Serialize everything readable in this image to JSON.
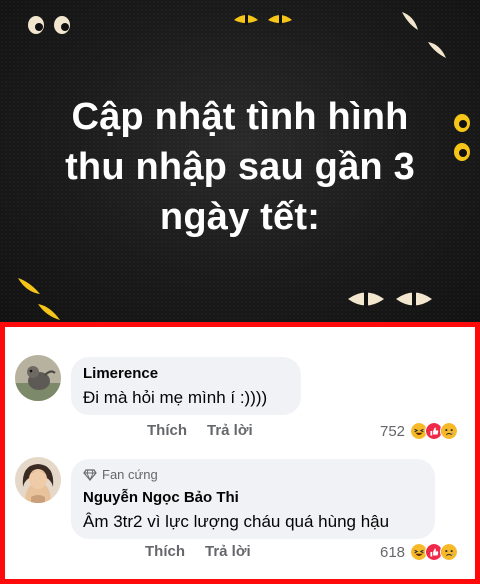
{
  "post": {
    "title_lines": [
      "Cập nhật tình hình",
      "thu nhập sau gần 3",
      "ngày tết:"
    ]
  },
  "comments": [
    {
      "author": "Limerence",
      "badge": "",
      "text": "Đi mà hỏi mẹ mình í :))))",
      "like_label": "Thích",
      "reply_label": "Trả lời",
      "reaction_count": "752",
      "reactions": [
        "haha",
        "like",
        "sad"
      ]
    },
    {
      "author": "Nguyễn Ngọc Bảo Thi",
      "badge": "Fan cứng",
      "text": "Âm 3tr2 vì lực lượng cháu quá hùng hậu",
      "like_label": "Thích",
      "reply_label": "Trả lời",
      "reaction_count": "618",
      "reactions": [
        "haha",
        "like",
        "sad"
      ]
    }
  ],
  "colors": {
    "banner_bg": "#1a1a1a",
    "eye_color": "#f5c518",
    "highlight_border": "#ff0a0a",
    "bubble_bg": "#f0f2f5",
    "secondary_text": "#65676b"
  }
}
